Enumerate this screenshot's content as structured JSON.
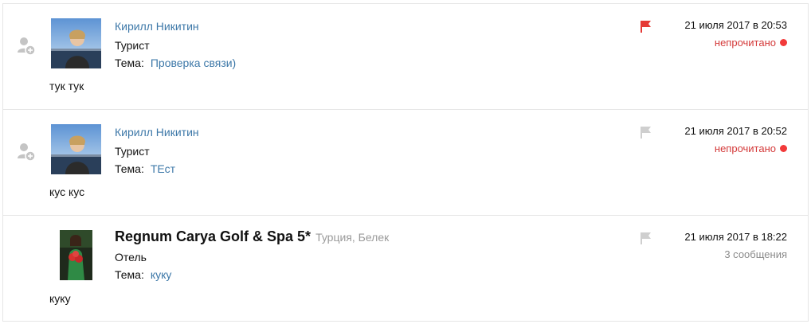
{
  "messages": [
    {
      "sender": "Кирилл Никитин",
      "role": "Турист",
      "topic_label": "Тема:",
      "topic": "Проверка связи)",
      "text": "тук тук",
      "date": "21 июля 2017 в 20:53",
      "status": "непрочитано",
      "flag_color": "#e53935",
      "flagged": true
    },
    {
      "sender": "Кирилл Никитин",
      "role": "Турист",
      "topic_label": "Тема:",
      "topic": "ТЕст",
      "text": "кус кус",
      "date": "21 июля 2017 в 20:52",
      "status": "непрочитано",
      "flag_color": "#cfcfcf",
      "flagged": false
    },
    {
      "sender": "Regnum Carya Golf & Spa 5*",
      "location": "Турция, Белек",
      "role": "Отель",
      "topic_label": "Тема:",
      "topic": "куку",
      "text": "куку",
      "date": "21 июля 2017 в 18:22",
      "status": "3 сообщения",
      "flag_color": "#cfcfcf",
      "flagged": false
    }
  ],
  "colors": {
    "link": "#3d78a8",
    "unread": "#d43a3a",
    "unread_dot": "#f23a3a",
    "muted": "#8a8a8a",
    "border": "#e6e6e6"
  },
  "icons": {
    "add_contact": "add-contact-icon",
    "flag": "flag-icon",
    "unread_dot": "unread-dot-icon"
  }
}
